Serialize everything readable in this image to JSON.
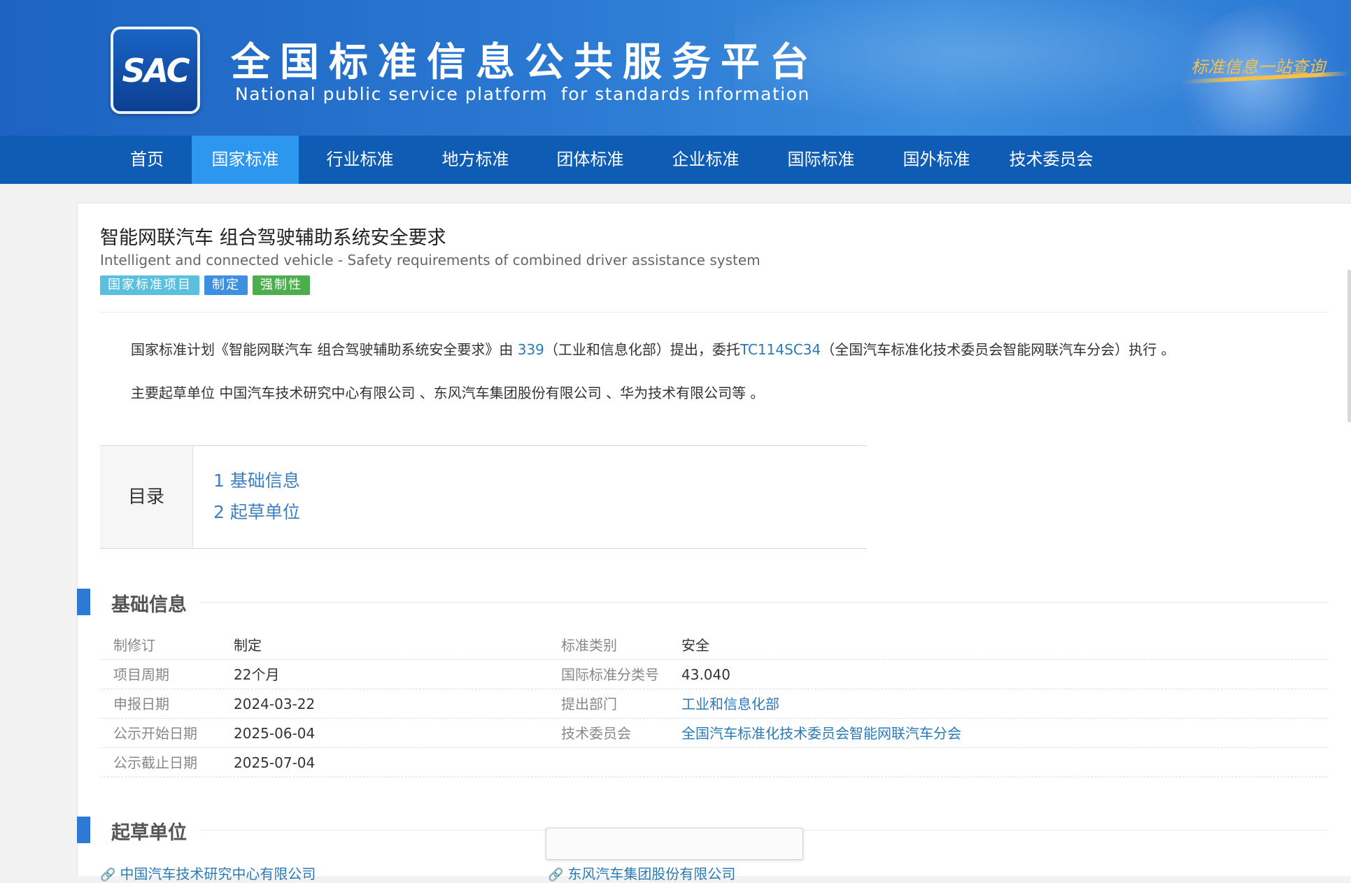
{
  "header": {
    "logo_text": "SAC",
    "title_cn": "全国标准信息公共服务平台",
    "title_en": "National public service platform  for standards information",
    "slogan": "标准信息一站查询"
  },
  "nav": {
    "items": [
      {
        "label": "首页",
        "active": false
      },
      {
        "label": "国家标准",
        "active": true
      },
      {
        "label": "行业标准",
        "active": false
      },
      {
        "label": "地方标准",
        "active": false
      },
      {
        "label": "团体标准",
        "active": false
      },
      {
        "label": "企业标准",
        "active": false
      },
      {
        "label": "国际标准",
        "active": false
      },
      {
        "label": "国外标准",
        "active": false
      },
      {
        "label": "技术委员会",
        "active": false
      }
    ]
  },
  "standard": {
    "title_cn": "智能网联汽车 组合驾驶辅助系统安全要求",
    "title_en": "Intelligent and connected vehicle - Safety requirements of combined driver assistance system",
    "tags": [
      {
        "label": "国家标准项目",
        "color": "#5bc0de"
      },
      {
        "label": "制定",
        "color": "#3f8fe0"
      },
      {
        "label": "强制性",
        "color": "#4cae4c"
      }
    ],
    "desc": {
      "p1_a": "国家标准计划《智能网联汽车 组合驾驶辅助系统安全要求》由 ",
      "p1_code1": "339",
      "p1_b": "（工业和信息化部）提出，委托",
      "p1_code2": "TC114SC34",
      "p1_c": "（全国汽车标准化技术委员会智能网联汽车分会）执行 。",
      "p2": "主要起草单位 中国汽车技术研究中心有限公司 、东风汽车集团股份有限公司 、华为技术有限公司等 。"
    }
  },
  "toc": {
    "heading": "目录",
    "items": [
      "1  基础信息",
      "2  起草单位"
    ]
  },
  "basic_info": {
    "section_title": "基础信息",
    "rows": [
      {
        "k1": "制修订",
        "v1": "制定",
        "k2": "标准类别",
        "v2": "安全"
      },
      {
        "k1": "项目周期",
        "v1": "22个月",
        "k2": "国际标准分类号",
        "v2": "43.040"
      },
      {
        "k1": "申报日期",
        "v1": "2024-03-22",
        "k2": "提出部门",
        "v2": "工业和信息化部"
      },
      {
        "k1": "公示开始日期",
        "v1": "2025-06-04",
        "k2": "技术委员会",
        "v2": "全国汽车标准化技术委员会智能网联汽车分会"
      },
      {
        "k1": "公示截止日期",
        "v1": "2025-07-04"
      }
    ]
  },
  "drafters": {
    "section_title": "起草单位",
    "items": [
      "中国汽车技术研究中心有限公司",
      "东风汽车集团股份有限公司"
    ]
  },
  "colors": {
    "banner": "#2a78d2",
    "nav_bg": "#0e5cb3",
    "nav_active": "#2d97f0",
    "link": "#2a7ab8",
    "section_bar": "#2d7ad6"
  }
}
